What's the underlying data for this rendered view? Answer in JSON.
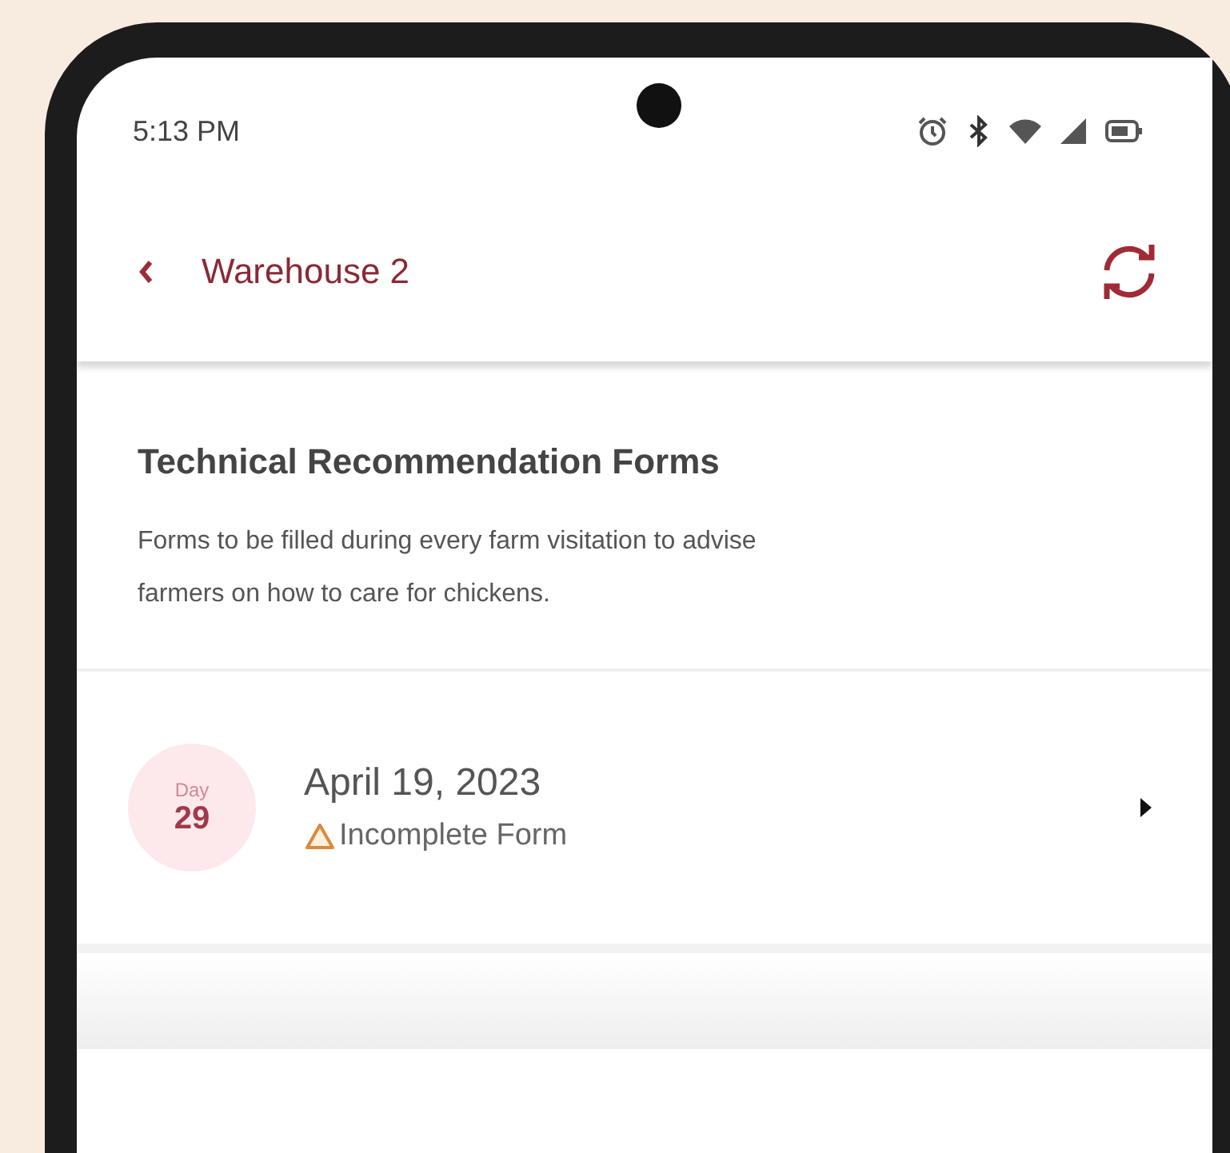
{
  "status_bar": {
    "time": "5:13 PM"
  },
  "header": {
    "title": "Warehouse 2"
  },
  "section": {
    "title": "Technical Recommendation Forms",
    "description": "Forms to be filled during every farm visitation to advise farmers on how to care for chickens."
  },
  "forms": [
    {
      "day_label": "Day",
      "day": "29",
      "date": "April 19, 2023",
      "status": "Incomplete Form",
      "kind": "incomplete"
    }
  ]
}
